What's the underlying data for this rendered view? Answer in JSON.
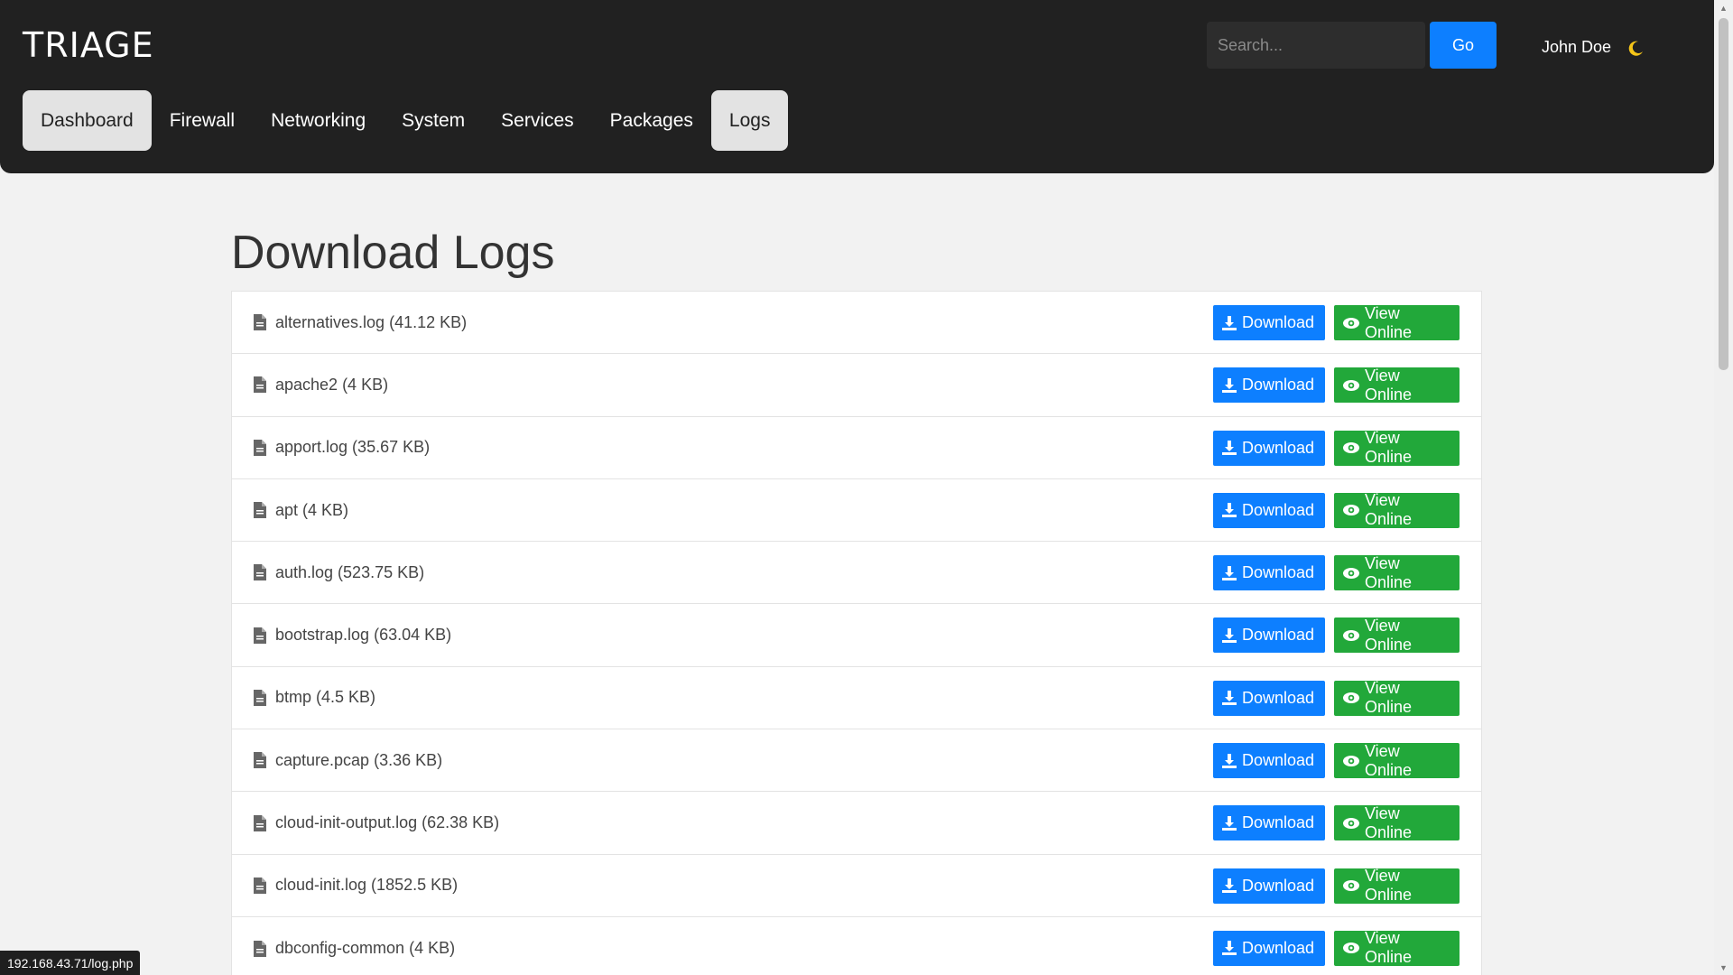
{
  "brand": "TRIAGE",
  "search": {
    "placeholder": "Search...",
    "go_label": "Go"
  },
  "user": {
    "name": "John Doe",
    "theme_icon": "moon-icon"
  },
  "nav": [
    {
      "label": "Dashboard",
      "active": true
    },
    {
      "label": "Firewall",
      "active": false
    },
    {
      "label": "Networking",
      "active": false
    },
    {
      "label": "System",
      "active": false
    },
    {
      "label": "Services",
      "active": false
    },
    {
      "label": "Packages",
      "active": false
    },
    {
      "label": "Logs",
      "active": true
    }
  ],
  "page_title": "Download Logs",
  "actions": {
    "download_label": "Download",
    "view_label": "View Online"
  },
  "logs": [
    {
      "name": "alternatives.log (41.12 KB)"
    },
    {
      "name": "apache2 (4 KB)"
    },
    {
      "name": "apport.log (35.67 KB)"
    },
    {
      "name": "apt (4 KB)"
    },
    {
      "name": "auth.log (523.75 KB)"
    },
    {
      "name": "bootstrap.log (63.04 KB)"
    },
    {
      "name": "btmp (4.5 KB)"
    },
    {
      "name": "capture.pcap (3.36 KB)"
    },
    {
      "name": "cloud-init-output.log (62.38 KB)"
    },
    {
      "name": "cloud-init.log (1852.5 KB)"
    },
    {
      "name": "dbconfig-common (4 KB)"
    }
  ],
  "status_url": "192.168.43.71/log.php",
  "colors": {
    "primary": "#0d7fff",
    "success": "#22a83a",
    "header": "#212121"
  }
}
